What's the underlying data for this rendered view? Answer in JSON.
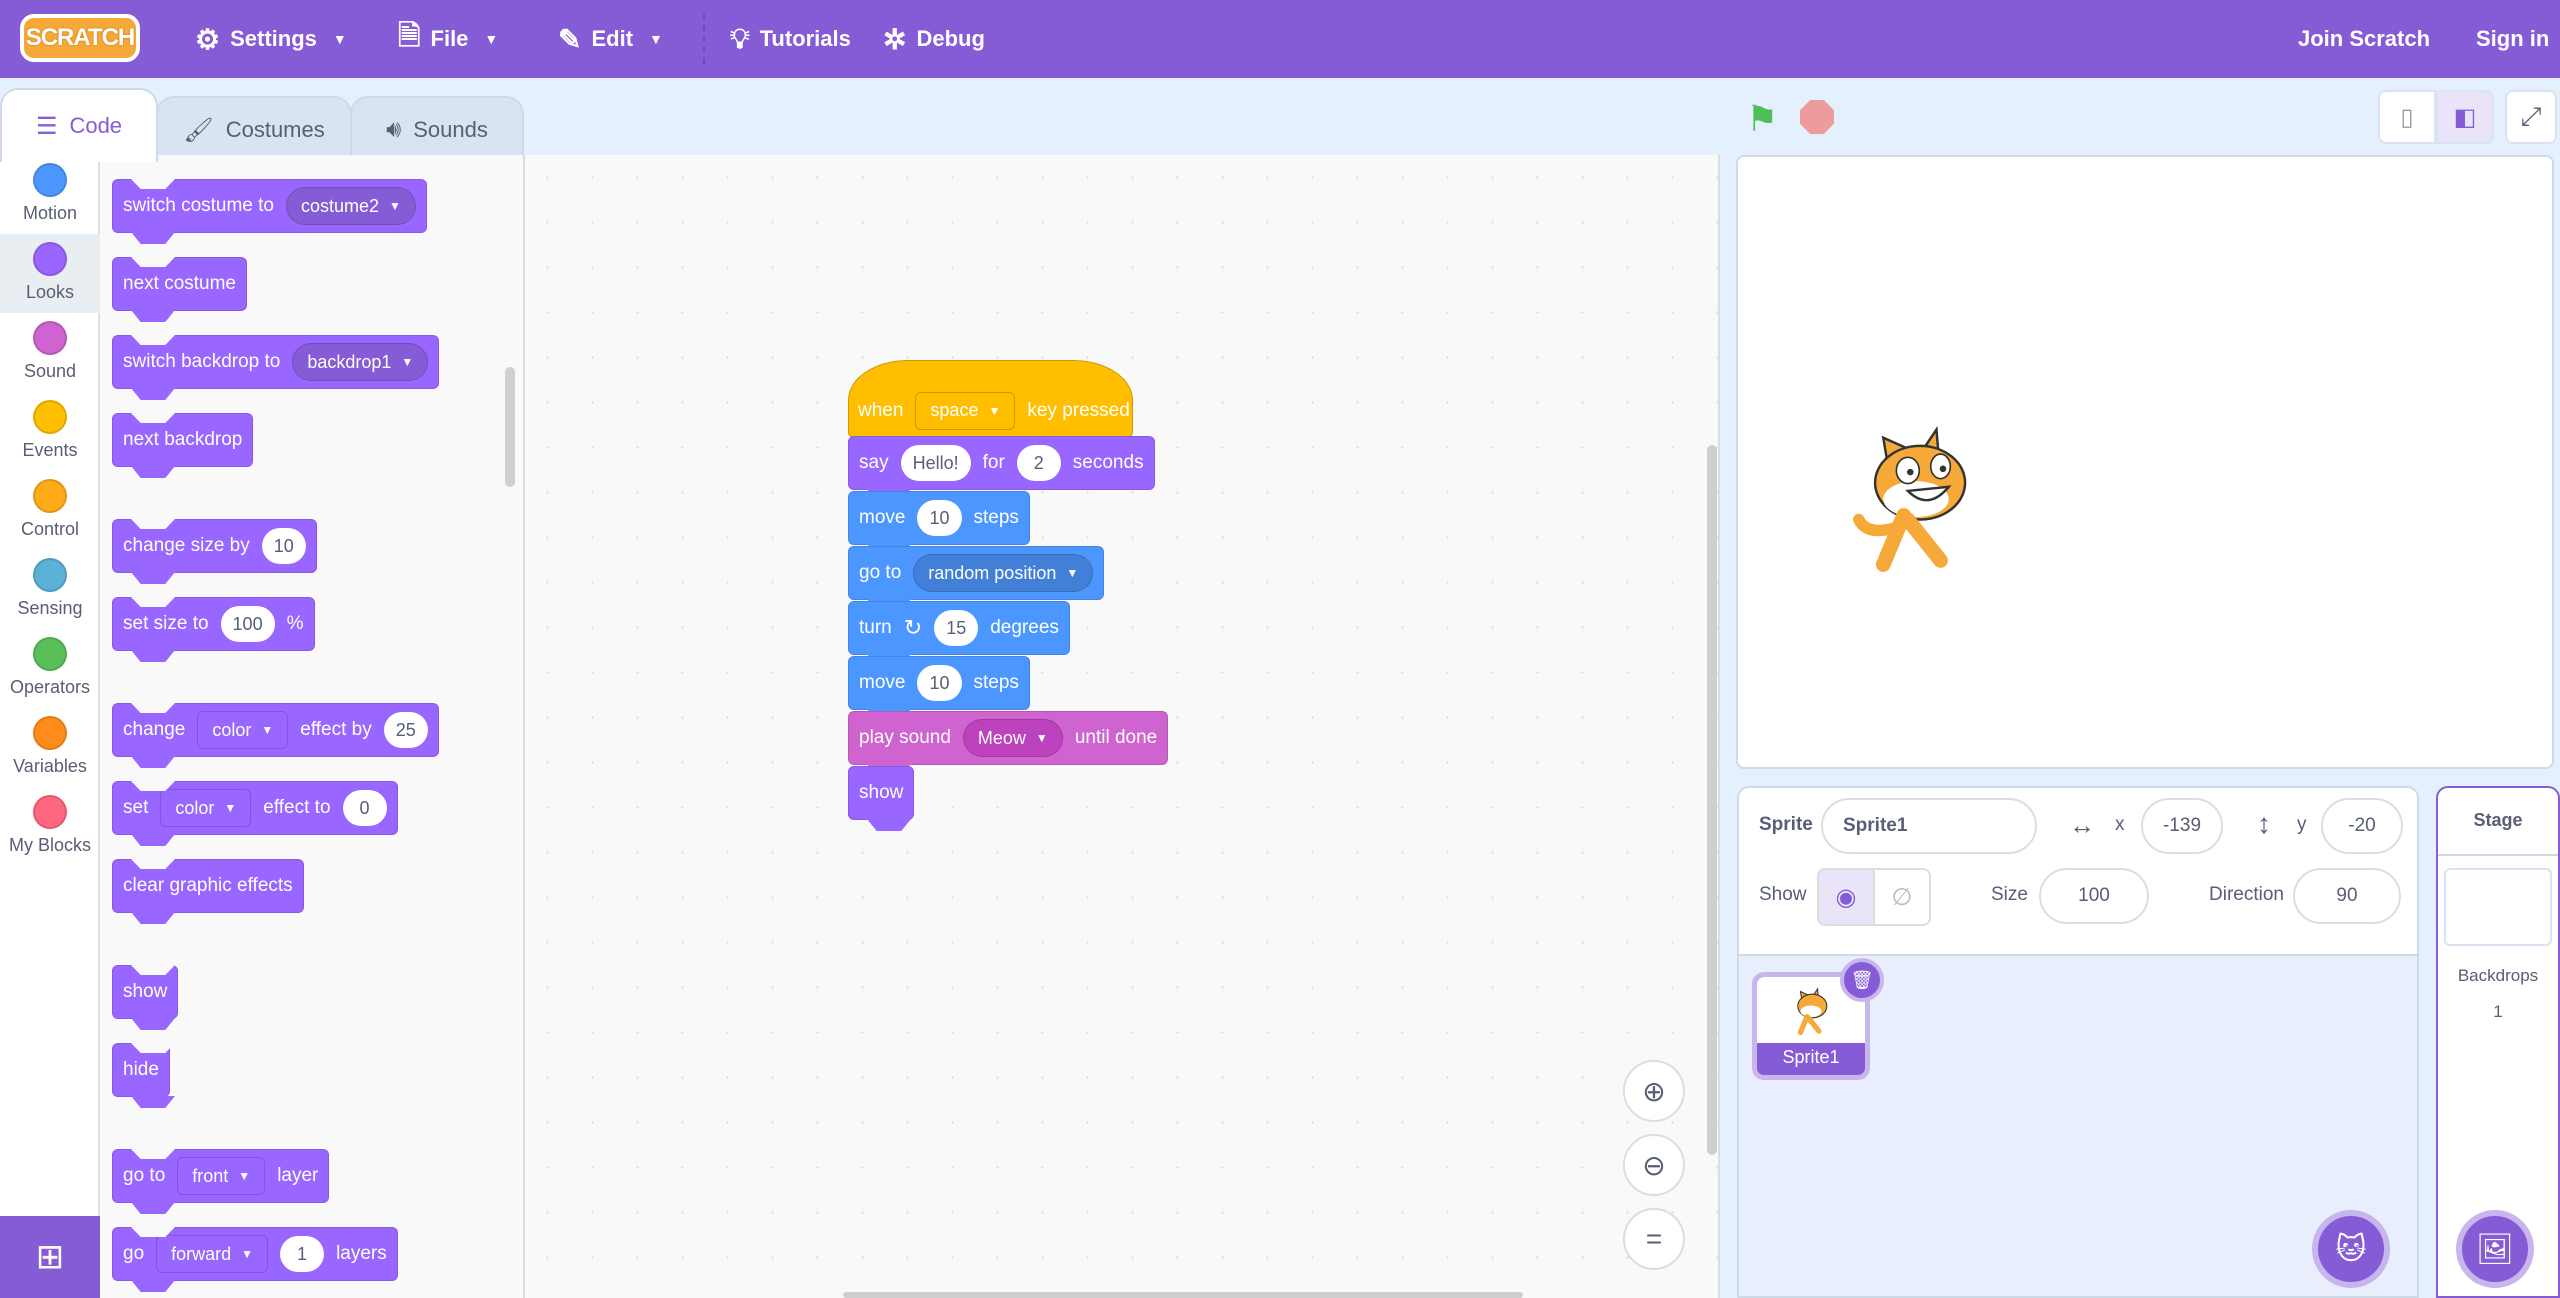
{
  "menubar": {
    "logo": "SCRATCH",
    "settings": "Settings",
    "file": "File",
    "edit": "Edit",
    "tutorials": "Tutorials",
    "debug": "Debug",
    "join": "Join Scratch",
    "signin": "Sign in"
  },
  "tabs": [
    {
      "label": "Code",
      "active": true
    },
    {
      "label": "Costumes"
    },
    {
      "label": "Sounds"
    }
  ],
  "categories": [
    {
      "label": "Motion",
      "color": "#4c97ff"
    },
    {
      "label": "Looks",
      "color": "#9966ff",
      "selected": true
    },
    {
      "label": "Sound",
      "color": "#cf63cf"
    },
    {
      "label": "Events",
      "color": "#ffbf00"
    },
    {
      "label": "Control",
      "color": "#ffab19"
    },
    {
      "label": "Sensing",
      "color": "#5cb1d6"
    },
    {
      "label": "Operators",
      "color": "#59c059"
    },
    {
      "label": "Variables",
      "color": "#ff8c1a"
    },
    {
      "label": "My Blocks",
      "color": "#ff6680"
    }
  ],
  "palette": {
    "switch_costume": {
      "text": "switch costume to",
      "value": "costume2"
    },
    "next_costume": "next costume",
    "switch_backdrop": {
      "text": "switch backdrop to",
      "value": "backdrop1"
    },
    "next_backdrop": "next backdrop",
    "change_size": {
      "text": "change size by",
      "value": "10"
    },
    "set_size": {
      "text": "set size to",
      "value": "100",
      "suffix": "%"
    },
    "change_effect": {
      "text": "change",
      "effect": "color",
      "text2": "effect by",
      "value": "25"
    },
    "set_effect": {
      "text": "set",
      "effect": "color",
      "text2": "effect to",
      "value": "0"
    },
    "clear_effects": "clear graphic effects",
    "show": "show",
    "hide": "hide",
    "go_layer": {
      "text": "go to",
      "value": "front",
      "text2": "layer"
    },
    "go_layers": {
      "text": "go",
      "value": "forward",
      "num": "1",
      "text2": "layers"
    }
  },
  "script": {
    "hat": {
      "text": "when",
      "key": "space",
      "text2": "key pressed"
    },
    "say": {
      "text": "say",
      "msg": "Hello!",
      "text2": "for",
      "secs": "2",
      "text3": "seconds"
    },
    "move1": {
      "text": "move",
      "value": "10",
      "text2": "steps"
    },
    "goto": {
      "text": "go to",
      "value": "random position"
    },
    "turn": {
      "text": "turn",
      "value": "15",
      "text2": "degrees"
    },
    "move2": {
      "text": "move",
      "value": "10",
      "text2": "steps"
    },
    "play": {
      "text": "play sound",
      "value": "Meow",
      "text2": "until done"
    },
    "show": "show"
  },
  "sprite_info": {
    "sprite_label": "Sprite",
    "sprite_name": "Sprite1",
    "x_label": "x",
    "x": "-139",
    "y_label": "y",
    "y": "-20",
    "show_label": "Show",
    "size_label": "Size",
    "size": "100",
    "direction_label": "Direction",
    "direction": "90"
  },
  "sprites": [
    {
      "name": "Sprite1",
      "selected": true
    }
  ],
  "stage_pane": {
    "title": "Stage",
    "backdrops_label": "Backdrops",
    "backdrops_count": "1"
  }
}
